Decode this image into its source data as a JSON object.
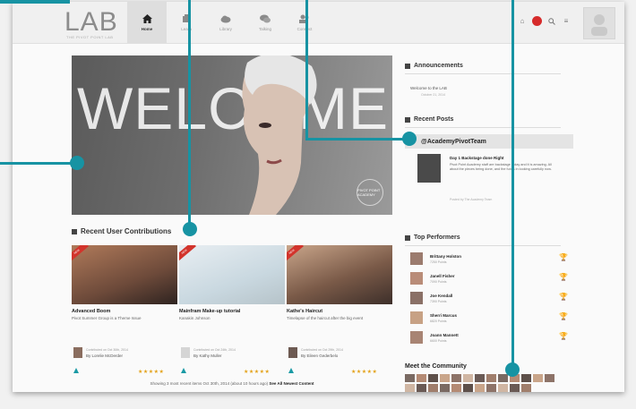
{
  "logo": {
    "text": "LAB",
    "sub": "THE PIVOT POINT LAB"
  },
  "nav": [
    {
      "label": "Home",
      "icon": "home-icon",
      "active": true
    },
    {
      "label": "Learn",
      "icon": "learn-icon",
      "active": false
    },
    {
      "label": "Library",
      "icon": "cloud-icon",
      "active": false
    },
    {
      "label": "Talking",
      "icon": "chat-icon",
      "active": false
    },
    {
      "label": "Connect",
      "icon": "people-icon",
      "active": false
    }
  ],
  "hero": {
    "text": "WELCOME",
    "badge": "PIVOT POINT ACADEMY"
  },
  "recent": {
    "title": "Recent User Contributions",
    "cards": [
      {
        "title": "Advanced Boom",
        "desc": "Pivot Summer Group is a Theme Issue",
        "date": "Contributed on Oct 30th, 2014",
        "by": "By Lorelie McDerder",
        "badge": "NEW"
      },
      {
        "title": "Mainfram Make-up tutorial",
        "desc": "Kanakin Johnson",
        "date": "Contributed on Oct 24th, 2014",
        "by": "By Kathy Muller",
        "badge": "NEW"
      },
      {
        "title": "Kathe's Haircut",
        "desc": "Timelapse of the haircut after the big event",
        "date": "Contributed on Oct 29th, 2014",
        "by": "By Eileen Gederbelo",
        "badge": "NEW"
      }
    ],
    "stars": "★★★★★",
    "footer_pre": "Showing 3 most recent items Oct 30th, 2014 (about 10 hours ago)",
    "footer_link": "See All Newest Content"
  },
  "announcements": {
    "title": "Announcements",
    "item": "Welcome to the LAB",
    "sub": "October 21, 2014"
  },
  "posts": {
    "title": "Recent Posts",
    "tag": "@AcademyPivotTeam",
    "post_title": "Day 1 Backstage done Right",
    "post_body": "Pivot Point Academy staff are backstage today and it is amazing. All about the pieces being done, and the fun is in looking carefully now.",
    "post_foot": "Posted by The Academy Team"
  },
  "performers": {
    "title": "Top Performers",
    "list": [
      {
        "name": "Brittany Holston",
        "pts": "7250 Points"
      },
      {
        "name": "Janell Fisher",
        "pts": "7090 Points"
      },
      {
        "name": "Joe Kendall",
        "pts": "7390 Points"
      },
      {
        "name": "Sherri Marcus",
        "pts": "6820 Points"
      },
      {
        "name": "Joann Mannett",
        "pts": "6600 Points"
      }
    ]
  },
  "community": {
    "title": "Meet the Community",
    "count": 24
  },
  "colors": {
    "accent": "#1793a3",
    "star": "#e3a21a",
    "ribbon": "#d2342c"
  }
}
